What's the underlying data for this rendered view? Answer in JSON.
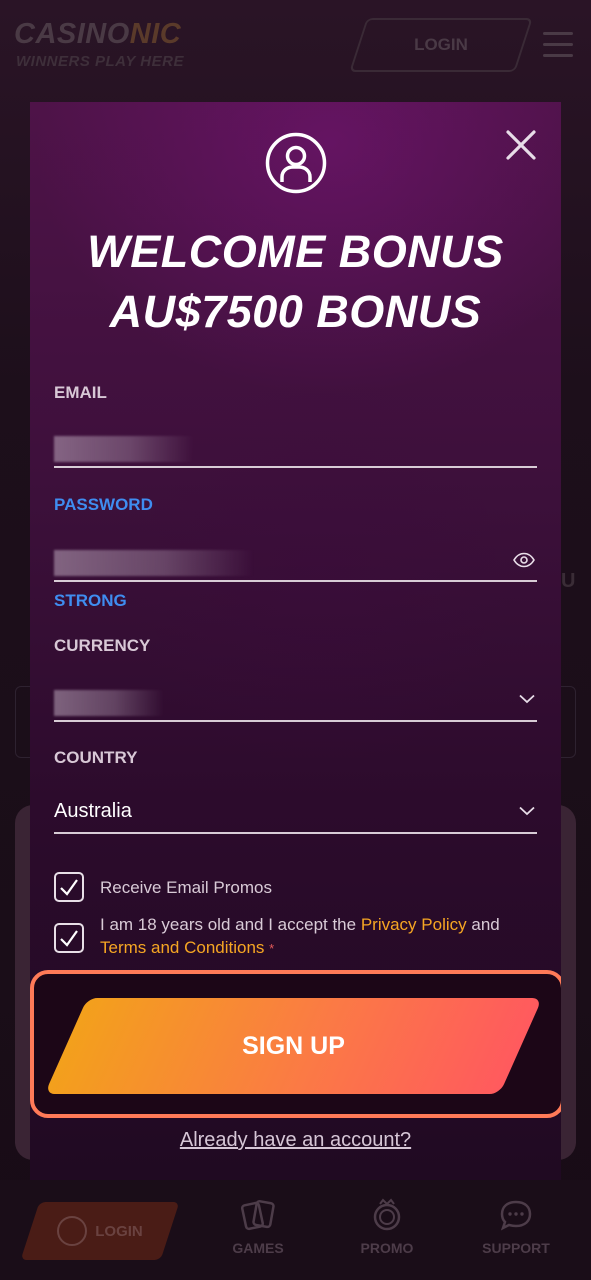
{
  "header": {
    "logo_main": "CASINO",
    "logo_accent": "NIC",
    "logo_tagline": "WINNERS PLAY HERE",
    "login_label": "LOGIN"
  },
  "background": {
    "side_letter": "U"
  },
  "modal": {
    "title_line1": "WELCOME BONUS",
    "title_line2": "AU$7500 BONUS",
    "email": {
      "label": "EMAIL",
      "value": ""
    },
    "password": {
      "label": "PASSWORD",
      "value": "",
      "strength": "STRONG"
    },
    "currency": {
      "label": "CURRENCY",
      "value": ""
    },
    "country": {
      "label": "COUNTRY",
      "value": "Australia"
    },
    "checkboxes": {
      "promos": {
        "label": "Receive Email Promos",
        "checked": true
      },
      "terms": {
        "prefix": "I am 18 years old and I accept the ",
        "privacy_link": "Privacy Policy",
        "mid": " and",
        "terms_link": "Terms and Conditions",
        "required_mark": "*",
        "checked": true
      }
    },
    "signup_label": "SIGN UP",
    "already_account": "Already have an account?"
  },
  "bottom_nav": {
    "items": [
      {
        "label": "LOGIN",
        "icon": "user-icon"
      },
      {
        "label": "GAMES",
        "icon": "cards-icon"
      },
      {
        "label": "PROMO",
        "icon": "coin-icon"
      },
      {
        "label": "SUPPORT",
        "icon": "chat-icon"
      }
    ]
  },
  "colors": {
    "accent_orange": "#f6a623",
    "accent_blue": "#3f8df0",
    "signup_gradient_start": "#f3a01c",
    "signup_gradient_end": "#ff5a5e",
    "modal_purple": "#4e1348"
  }
}
